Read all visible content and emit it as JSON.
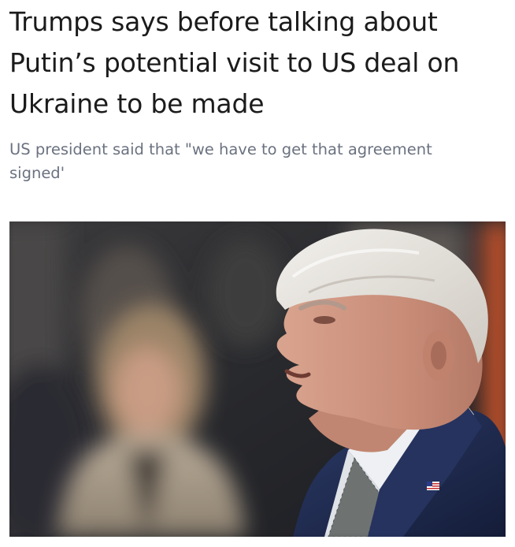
{
  "article": {
    "headline": "Trumps says before talking about Putin’s potential visit to US deal on Ukraine to be made",
    "subtitle": "US president said that \"we have to get that agreement signed'",
    "image": {
      "icon": "news-photo",
      "description_icon": "flag-pin-icon"
    }
  },
  "colors": {
    "headline": "#1b1b1b",
    "subtitle": "#6b7280",
    "suit": "#1f2d55",
    "shirt": "#eef0f3",
    "hair": "#e2e0dc",
    "background_accent": "#c4552a"
  }
}
